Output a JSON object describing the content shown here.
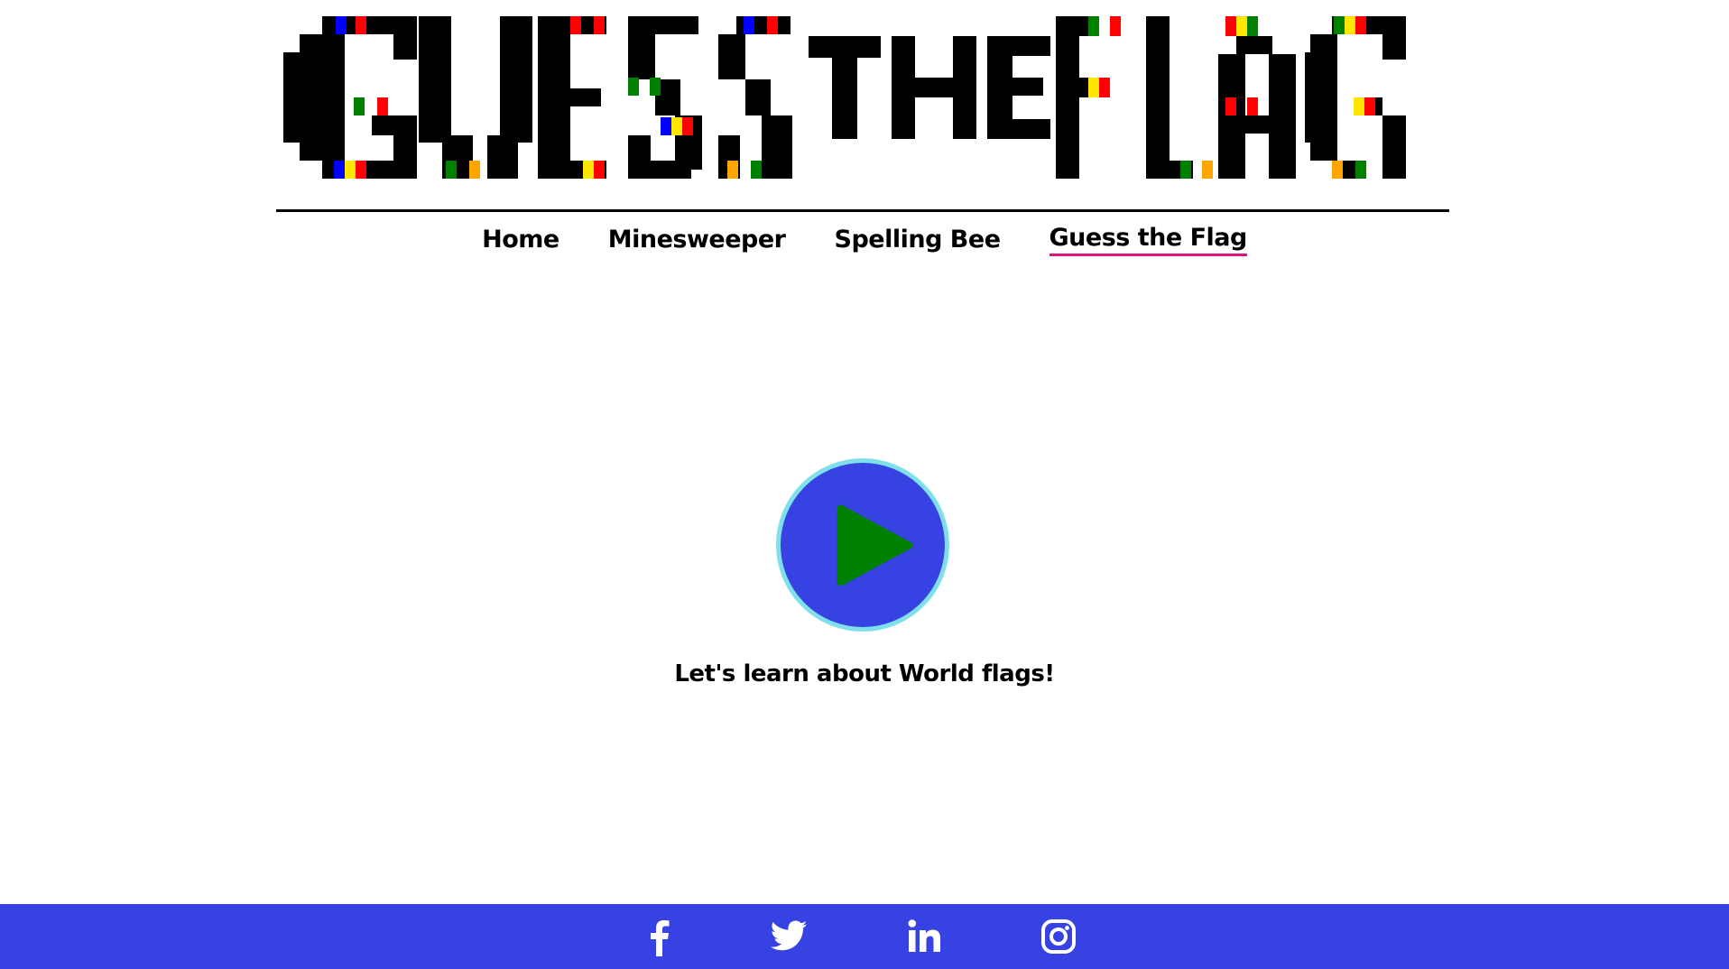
{
  "banner": {
    "letters": [
      "G",
      "U",
      "E",
      "S",
      "S",
      "T",
      "H",
      "E",
      "F",
      "L",
      "A",
      "G"
    ],
    "pixel_colors": {
      "ink": "#000000",
      "blue": "#0000ff",
      "red": "#ff0000",
      "green": "#008000",
      "yellow": "#ffe600",
      "orange": "#ffa500"
    }
  },
  "nav": {
    "items": [
      {
        "label": "Home",
        "active": false
      },
      {
        "label": "Minesweeper",
        "active": false
      },
      {
        "label": "Spelling Bee",
        "active": false
      },
      {
        "label": "Guess the Flag",
        "active": true
      }
    ],
    "active_underline_color": "#e0157a"
  },
  "main": {
    "play_button_icon": "play-icon",
    "play_button_colors": {
      "fill": "#3643e2",
      "ring": "#7fe0ec",
      "triangle": "#008000"
    },
    "tagline": "Let's learn about World flags!"
  },
  "footer": {
    "background": "#3643e2",
    "socials": [
      {
        "icon": "facebook-icon"
      },
      {
        "icon": "twitter-icon"
      },
      {
        "icon": "linkedin-icon"
      },
      {
        "icon": "instagram-icon"
      }
    ]
  }
}
